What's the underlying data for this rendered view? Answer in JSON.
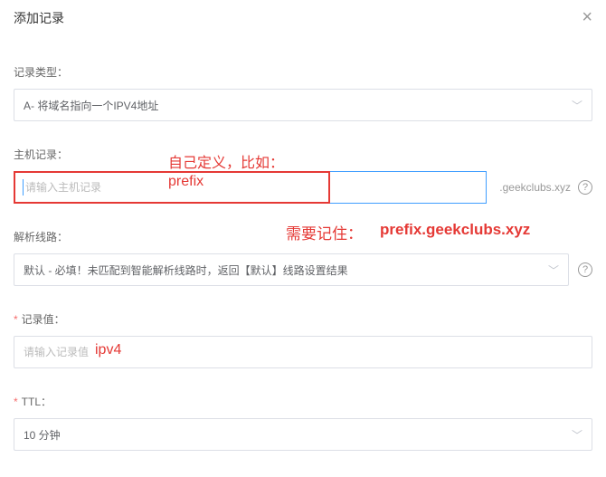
{
  "header": {
    "title": "添加记录",
    "close": "×"
  },
  "record_type": {
    "label": "记录类型：",
    "value": "A- 将域名指向一个IPV4地址"
  },
  "host_record": {
    "label": "主机记录：",
    "placeholder": "请输入主机记录",
    "suffix": ".geekclubs.xyz"
  },
  "route": {
    "label": "解析线路：",
    "value": "默认 - 必填！未匹配到智能解析线路时，返回【默认】线路设置结果"
  },
  "record_value": {
    "label": "记录值：",
    "placeholder": "请输入记录值"
  },
  "ttl": {
    "label": "TTL：",
    "value": "10 分钟"
  },
  "annotations": {
    "define_hint": "自己定义，比如：",
    "prefix": "prefix",
    "remember": "需要记住：",
    "full_domain": "prefix.geekclubs.xyz",
    "ipv4": "ipv4"
  },
  "help": "?"
}
